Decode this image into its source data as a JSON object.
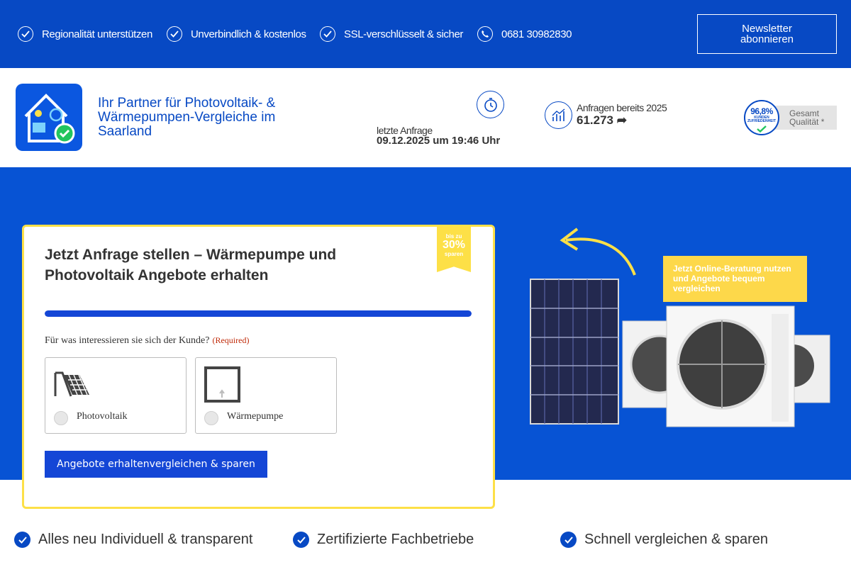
{
  "topbar": {
    "usps": [
      {
        "label": "Regionalität unterstützen",
        "icon": "check-icon"
      },
      {
        "label": "Unverbindlich & kostenlos",
        "icon": "check-icon"
      },
      {
        "label": "SSL-verschlüsselt & sicher",
        "icon": "check-icon"
      },
      {
        "label": "0681 30982830",
        "icon": "phone-icon"
      }
    ],
    "newsletter_label": "Newsletter abonnieren"
  },
  "header": {
    "tagline": "Ihr Partner für Photovoltaik- & Wärmepumpen-Vergleiche im Saarland",
    "last_request": {
      "label": "letzte Anfrage",
      "value": "09.12.2025 um 19:46 Uhr"
    },
    "requests": {
      "label": "Anfragen bereits 2025",
      "value": "61.273 ➦"
    },
    "rating": {
      "seal_percent": "96,8%",
      "seal_sub": "KUNDEN ZUFRIEDENHEIT",
      "label": "Gesamt Qualität *"
    }
  },
  "form": {
    "ribbon": {
      "line1": "bis zu",
      "line2": "30%",
      "line3": "sparen"
    },
    "title": "Jetzt Anfrage stellen – Wärmepumpe und Photovoltaik Angebote erhalten",
    "progress": 1.0,
    "question": "Für was interessieren sie sich der Kunde?",
    "required": "(Required)",
    "options": [
      {
        "label": "Photovoltaik",
        "icon": "solar-panel-icon"
      },
      {
        "label": "Wärmepumpe",
        "icon": "heat-pump-icon"
      }
    ],
    "submit_label": "Angebote erhaltenvergleichen & sparen"
  },
  "promo": "Jetzt Online-Beratung nutzen und Angebote bequem vergleichen",
  "bottom_usps": [
    {
      "label": "Alles neu Individuell & transparent"
    },
    {
      "label": "Zertifizierte Fachbetriebe"
    },
    {
      "label": "Schnell vergleichen & sparen"
    }
  ],
  "colors": {
    "brand_blue": "#0749c4",
    "hero_blue": "#0753d4",
    "accent_yellow": "#fde047",
    "button_blue": "#1446d6"
  }
}
